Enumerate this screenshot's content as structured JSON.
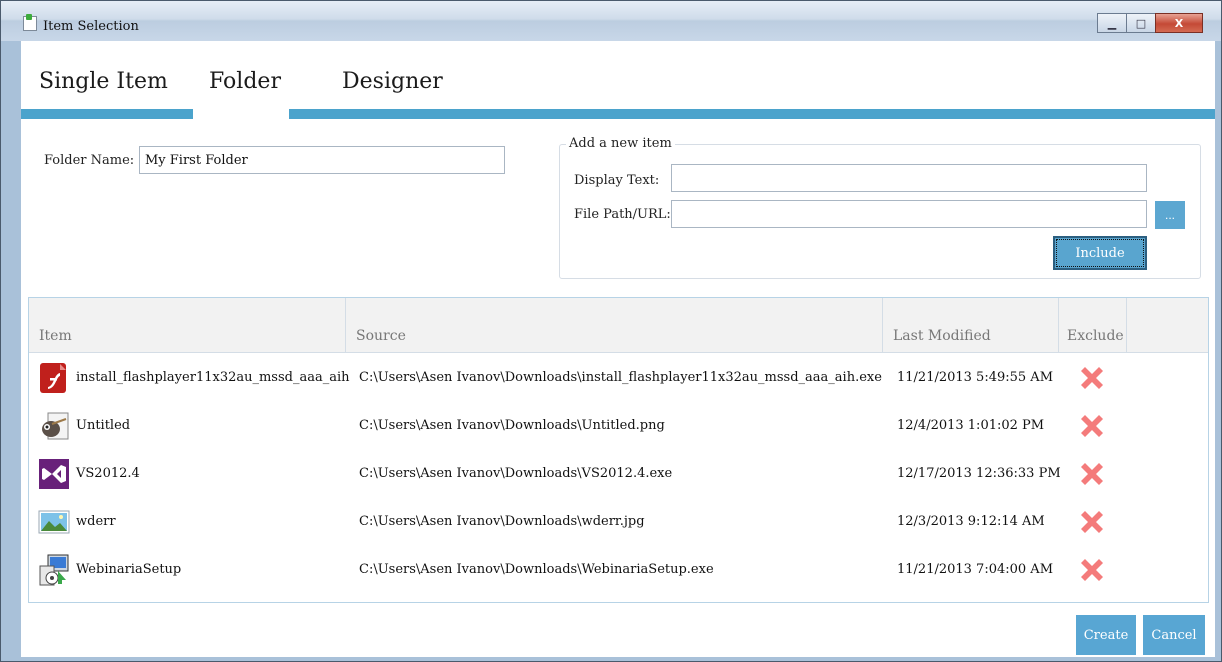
{
  "window": {
    "title": "Item Selection",
    "controls": {
      "minimize": "▁",
      "maximize": "□",
      "close": "X"
    }
  },
  "tabs": [
    {
      "label": "Single Item",
      "selected": false
    },
    {
      "label": "Folder",
      "selected": true
    },
    {
      "label": "Designer",
      "selected": false
    }
  ],
  "folder": {
    "name_label": "Folder Name:",
    "name_value": "My First Folder"
  },
  "add_item": {
    "legend": "Add a new item",
    "display_text_label": "Display Text:",
    "display_text_value": "",
    "file_path_label": "File Path/URL:",
    "file_path_value": "",
    "browse_label": "...",
    "include_label": "Include"
  },
  "grid": {
    "columns": [
      "Item",
      "Source",
      "Last Modified",
      "Exclude"
    ],
    "rows": [
      {
        "item": "install_flashplayer11x32au_mssd_aaa_aih",
        "source": "C:\\Users\\Asen Ivanov\\Downloads\\install_flashplayer11x32au_mssd_aaa_aih.exe",
        "modified": "11/21/2013 5:49:55 AM",
        "icon": "flash-icon"
      },
      {
        "item": "Untitled",
        "source": "C:\\Users\\Asen Ivanov\\Downloads\\Untitled.png",
        "modified": "12/4/2013 1:01:02 PM",
        "icon": "gimp-icon"
      },
      {
        "item": "VS2012.4",
        "source": "C:\\Users\\Asen Ivanov\\Downloads\\VS2012.4.exe",
        "modified": "12/17/2013 12:36:33 PM",
        "icon": "visual-studio-icon"
      },
      {
        "item": "wderr",
        "source": "C:\\Users\\Asen Ivanov\\Downloads\\wderr.jpg",
        "modified": "12/3/2013 9:12:14 AM",
        "icon": "image-file-icon"
      },
      {
        "item": "WebinariaSetup",
        "source": "C:\\Users\\Asen Ivanov\\Downloads\\WebinariaSetup.exe",
        "modified": "11/21/2013 7:04:00 AM",
        "icon": "installer-icon"
      }
    ]
  },
  "actions": {
    "create_label": "Create",
    "cancel_label": "Cancel"
  },
  "colors": {
    "accent": "#4ba3cc",
    "button": "#58a6d3",
    "exclude": "#f47b7b"
  }
}
